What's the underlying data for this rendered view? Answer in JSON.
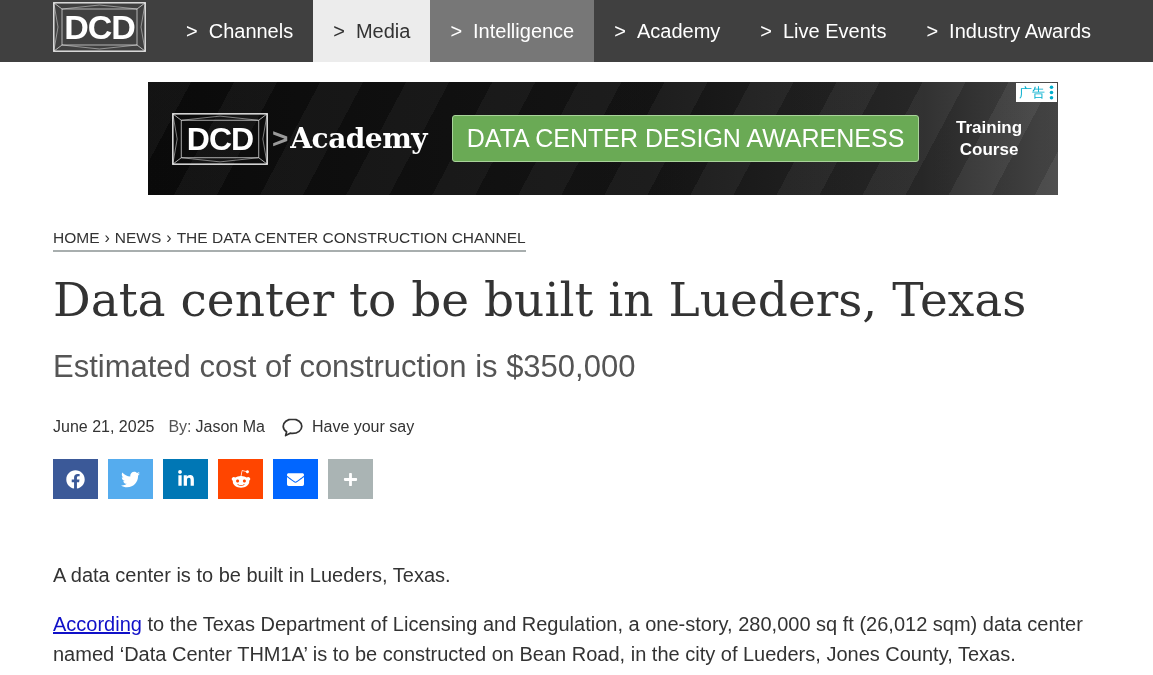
{
  "nav": {
    "logo": "DCD",
    "items": [
      {
        "marker": ">",
        "label": "Channels",
        "selected": false,
        "highlighted": false
      },
      {
        "marker": ">",
        "label": "Media",
        "selected": true,
        "highlighted": false
      },
      {
        "marker": ">",
        "label": "Intelligence",
        "selected": false,
        "highlighted": true
      },
      {
        "marker": ">",
        "label": "Academy",
        "selected": false,
        "highlighted": false
      },
      {
        "marker": ">",
        "label": "Live Events",
        "selected": false,
        "highlighted": false
      },
      {
        "marker": ">",
        "label": "Industry Awards",
        "selected": false,
        "highlighted": false
      }
    ]
  },
  "ad": {
    "badge": "广告",
    "logo": "DCD",
    "separator": ">",
    "product": "Academy",
    "headline": "DATA CENTER DESIGN AWARENESS",
    "tagline": "Training Course"
  },
  "breadcrumb": {
    "items": [
      "HOME",
      "NEWS",
      "THE DATA CENTER CONSTRUCTION CHANNEL"
    ],
    "separators": [
      "›",
      "›"
    ]
  },
  "article": {
    "title": "Data center to be built in Lueders, Texas",
    "subtitle": "Estimated cost of construction is $350,000",
    "date": "June 21, 2025",
    "byline_label": "By:",
    "author": "Jason Ma",
    "comments_link": "Have your say",
    "share_buttons": [
      {
        "kind": "facebook",
        "color": "#3b5998"
      },
      {
        "kind": "twitter",
        "color": "#55acee"
      },
      {
        "kind": "linkedin",
        "color": "#0077b5"
      },
      {
        "kind": "reddit",
        "color": "#ff4500"
      },
      {
        "kind": "email",
        "color": "#0166ff"
      },
      {
        "kind": "more",
        "color": "#aab4b4"
      }
    ],
    "paragraphs": [
      {
        "text": "A data center is to be built in Lueders, Texas."
      },
      {
        "link": "According",
        "text": "to the Texas Department of Licensing and Regulation, a one-story, 280,000 sq ft (26,012 sqm) data center named ‘Data Center THM1A’ is to be constructed on Bean Road, in the city of Lueders, Jones County, Texas."
      }
    ]
  }
}
